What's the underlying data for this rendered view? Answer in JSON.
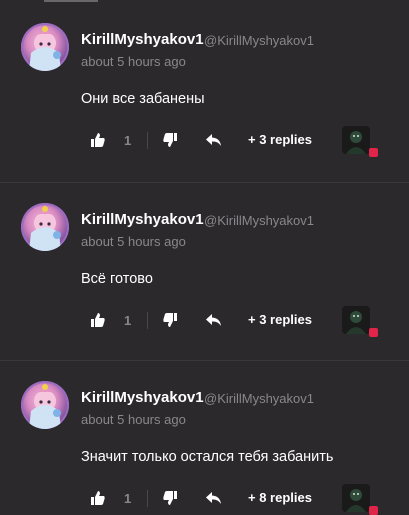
{
  "comments": [
    {
      "username": "KirillMyshyakov1",
      "handle": "@KirillMyshyakov1",
      "timestamp": "about 5 hours ago",
      "text": "Они все забанены",
      "like_count": "1",
      "replies_label": "+ 3 replies"
    },
    {
      "username": "KirillMyshyakov1",
      "handle": "@KirillMyshyakov1",
      "timestamp": "about 5 hours ago",
      "text": "Всё готово",
      "like_count": "1",
      "replies_label": "+ 3 replies"
    },
    {
      "username": "KirillMyshyakov1",
      "handle": "@KirillMyshyakov1",
      "timestamp": "about 5 hours ago",
      "text": "Значит только остался тебя забанить",
      "like_count": "1",
      "replies_label": "+ 8 replies"
    }
  ],
  "icons": {
    "like": "thumbs-up-icon",
    "dislike": "thumbs-down-icon",
    "reply": "reply-arrow-icon"
  },
  "colors": {
    "background": "#2c292d",
    "text_primary": "#ffffff",
    "text_muted": "#8a878c",
    "badge": "#e0244a"
  }
}
